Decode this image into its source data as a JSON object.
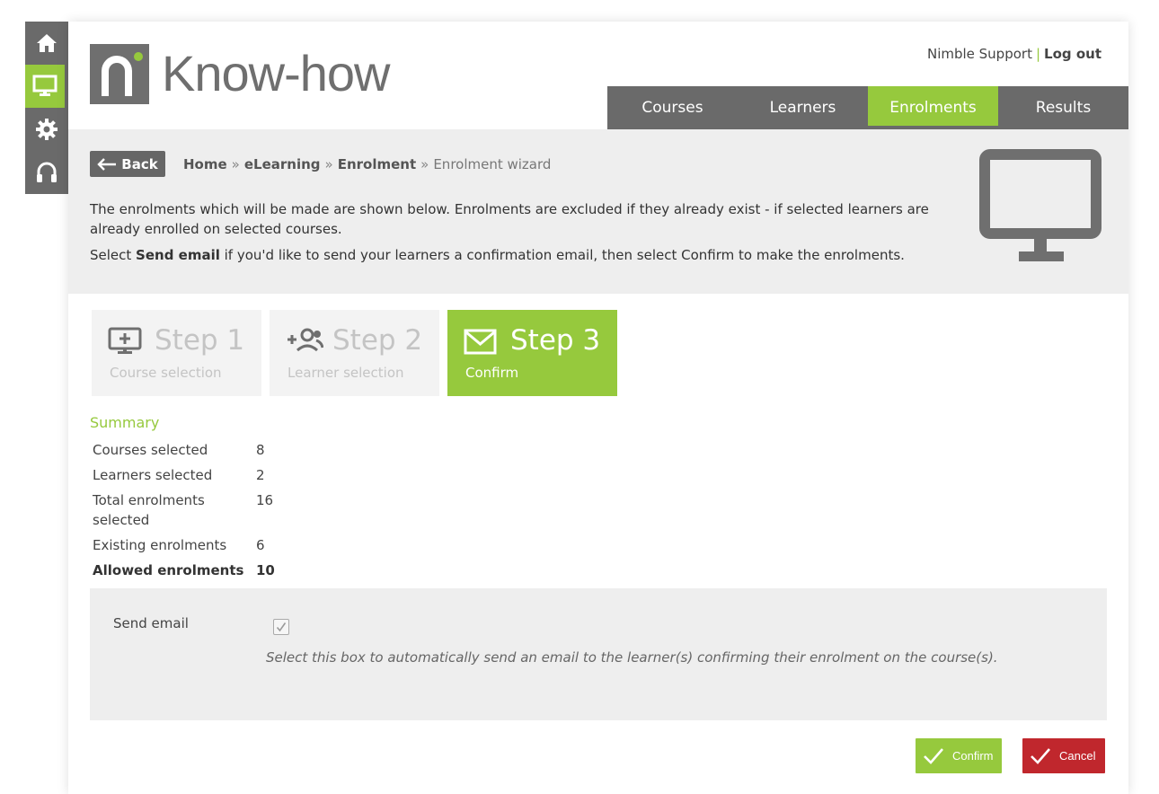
{
  "colors": {
    "accent": "#96c93d",
    "dark": "#6a6a6a",
    "danger": "#c0272d",
    "band": "#eeeeee"
  },
  "rail": [
    {
      "icon": "home-icon",
      "active": false
    },
    {
      "icon": "monitor-icon",
      "active": true
    },
    {
      "icon": "gear-icon",
      "active": false
    },
    {
      "icon": "headset-icon",
      "active": false
    }
  ],
  "brand": {
    "name": "Know-how"
  },
  "user": {
    "name": "Nimble Support",
    "separator": "|",
    "logout": "Log out"
  },
  "nav": {
    "tabs": [
      "Courses",
      "Learners",
      "Enrolments",
      "Results"
    ],
    "active": "Enrolments"
  },
  "header": {
    "back": "Back",
    "breadcrumb": [
      "Home",
      "eLearning",
      "Enrolment",
      "Enrolment wizard"
    ],
    "breadcrumb_sep": "»",
    "intro_line1": "The enrolments which will be made are shown below. Enrolments are excluded if they already exist - if selected learners are already enrolled on selected courses.",
    "intro_line2_pre": "Select ",
    "intro_line2_bold": "Send email",
    "intro_line2_post": " if you'd like to send your learners a confirmation email, then select Confirm to make the enrolments."
  },
  "steps": [
    {
      "title": "Step 1",
      "subtitle": "Course selection",
      "icon": "add-monitor-icon",
      "active": false
    },
    {
      "title": "Step 2",
      "subtitle": "Learner selection",
      "icon": "add-people-icon",
      "active": false
    },
    {
      "title": "Step 3",
      "subtitle": "Confirm",
      "icon": "envelope-icon",
      "active": true
    }
  ],
  "summary": {
    "title": "Summary",
    "rows": [
      {
        "label": "Courses selected",
        "value": "8"
      },
      {
        "label": "Learners selected",
        "value": "2"
      },
      {
        "label": "Total enrolments selected",
        "value": "16"
      },
      {
        "label": "Existing enrolments",
        "value": "6"
      },
      {
        "label": "Allowed enrolments",
        "value": "10"
      }
    ]
  },
  "email": {
    "label": "Send email",
    "checked": true,
    "help": "Select this box to automatically send an email to the learner(s) confirming their enrolment on the course(s)."
  },
  "actions": {
    "confirm": "Confirm",
    "cancel": "Cancel"
  }
}
